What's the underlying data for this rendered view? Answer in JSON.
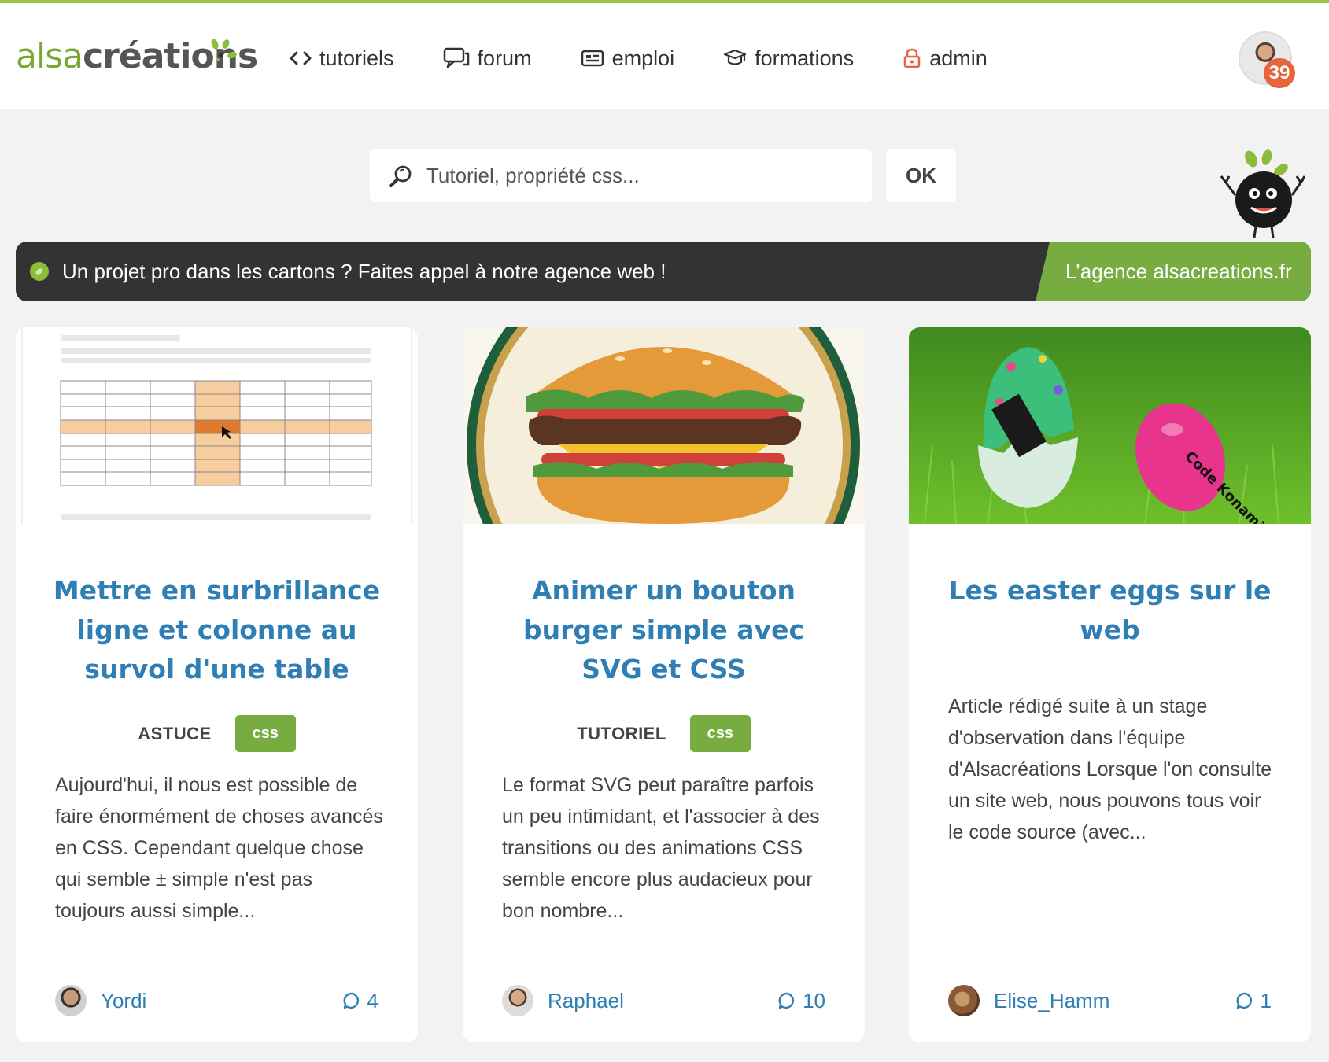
{
  "header": {
    "logo_light": "alsa",
    "logo_dark": "créations",
    "nav": [
      {
        "label": "tutoriels",
        "icon": "code-icon"
      },
      {
        "label": "forum",
        "icon": "chat-icon"
      },
      {
        "label": "emploi",
        "icon": "id-card-icon"
      },
      {
        "label": "formations",
        "icon": "graduation-cap-icon"
      },
      {
        "label": "admin",
        "icon": "lock-icon"
      }
    ],
    "notification_count": "39"
  },
  "search": {
    "placeholder": "Tutoriel, propriété css...",
    "submit_label": "OK"
  },
  "banner": {
    "text": "Un projet pro dans les cartons ? Faites appel à notre agence web !",
    "link_label": "L’agence alsacreations.fr"
  },
  "colors": {
    "brand_green": "#77ac40",
    "link_blue": "#2f7fb5",
    "banner_dark": "#333333",
    "badge_orange": "#e8643c"
  },
  "cards": [
    {
      "title": "Mettre en surbrillance ligne et colonne au survol d'une table",
      "type": "ASTUCE",
      "tag": "css",
      "excerpt": "Aujourd'hui, il nous est possible de faire énormément de choses avancés en CSS. Cependant quelque chose qui semble ± simple n'est pas toujours aussi simple...",
      "author": "Yordi",
      "comments": "4"
    },
    {
      "title": "Animer un bouton burger simple avec SVG et CSS",
      "type": "TUTORIEL",
      "tag": "css",
      "excerpt": "Le format SVG peut paraître parfois un peu intimidant, et l'associer à des transitions ou des animations CSS semble encore plus audacieux pour bon nombre...",
      "author": "Raphael",
      "comments": "10"
    },
    {
      "title": "Les easter eggs sur le web",
      "type": "",
      "tag": "",
      "excerpt": "Article rédigé suite à un stage d'observation dans l'équipe d'Alsacréations Lorsque l'on consulte un site web, nous pouvons tous voir le code source (avec...",
      "author": "Elise_Hamm",
      "comments": "1",
      "image_text": "Code Konami"
    }
  ]
}
